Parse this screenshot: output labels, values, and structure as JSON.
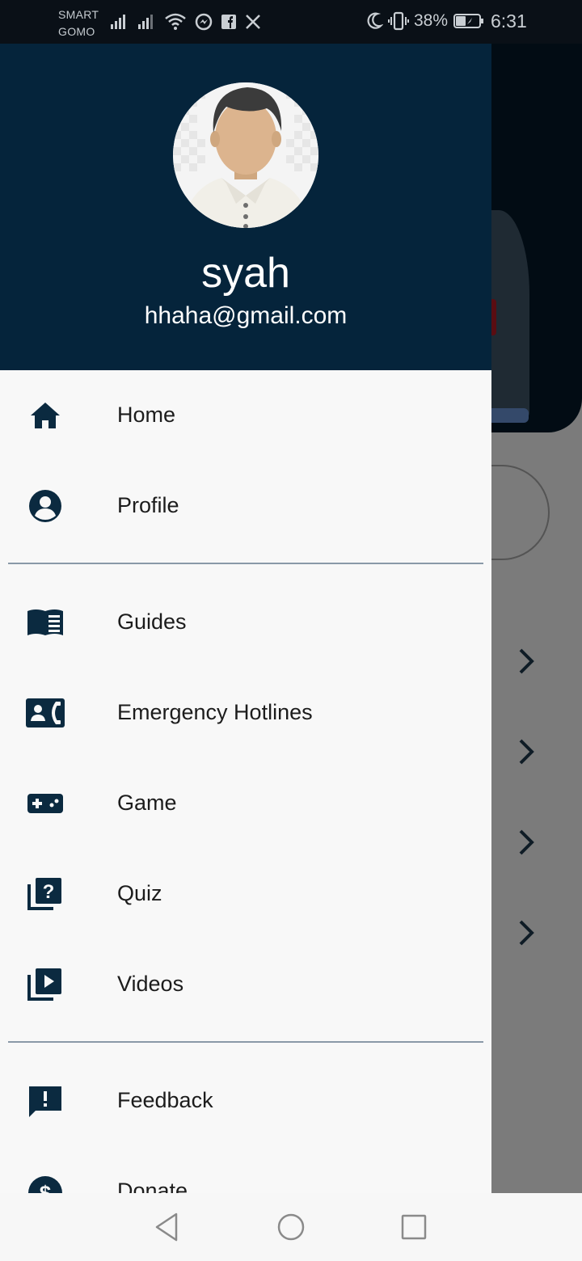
{
  "status_bar": {
    "carrier_line1": "SMART",
    "carrier_line2": "GOMO",
    "battery": "38%",
    "time": "6:31"
  },
  "drawer": {
    "user": {
      "name": "syah",
      "email": "hhaha@gmail.com"
    },
    "items": [
      {
        "label": "Home",
        "icon": "home-icon"
      },
      {
        "label": "Profile",
        "icon": "account-circle-icon"
      },
      {
        "label": "Guides",
        "icon": "book-icon"
      },
      {
        "label": "Emergency Hotlines",
        "icon": "contact-phone-icon"
      },
      {
        "label": "Game",
        "icon": "gamepad-icon"
      },
      {
        "label": "Quiz",
        "icon": "quiz-icon"
      },
      {
        "label": "Videos",
        "icon": "video-library-icon"
      },
      {
        "label": "Feedback",
        "icon": "feedback-icon"
      },
      {
        "label": "Donate",
        "icon": "donate-icon"
      }
    ]
  },
  "colors": {
    "header": "#05243b",
    "icon": "#0b2a40",
    "drawer_bg": "#f8f8f8"
  }
}
